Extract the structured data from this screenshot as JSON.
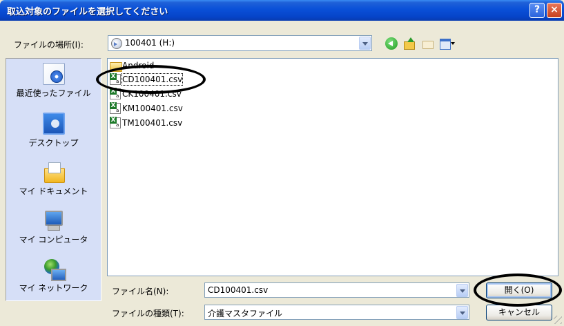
{
  "window": {
    "title": "取込対象のファイルを選択してください"
  },
  "toolbar": {
    "lookin_label": "ファイルの場所(I):",
    "lookin_value": "100401 (H:)"
  },
  "places": [
    {
      "label": "最近使ったファイル",
      "icon": "recent-documents-icon"
    },
    {
      "label": "デスクトップ",
      "icon": "desktop-icon"
    },
    {
      "label": "マイ ドキュメント",
      "icon": "my-documents-icon"
    },
    {
      "label": "マイ コンピュータ",
      "icon": "my-computer-icon"
    },
    {
      "label": "マイ ネットワーク",
      "icon": "my-network-icon"
    }
  ],
  "files": [
    {
      "name": "Android",
      "type": "folder"
    },
    {
      "name": "CD100401.csv",
      "type": "csv",
      "selected": true
    },
    {
      "name": "CK100401.csv",
      "type": "csv"
    },
    {
      "name": "KM100401.csv",
      "type": "csv"
    },
    {
      "name": "TM100401.csv",
      "type": "csv"
    }
  ],
  "filename": {
    "label": "ファイル名(N):",
    "value": "CD100401.csv"
  },
  "filetype": {
    "label": "ファイルの種類(T):",
    "value": "介護マスタファイル"
  },
  "buttons": {
    "open": "開く(O)",
    "cancel": "キャンセル"
  },
  "colors": {
    "titlebar": "#0a50d8",
    "places_bg": "#d6dff7",
    "dialog_bg": "#ece9d8"
  }
}
